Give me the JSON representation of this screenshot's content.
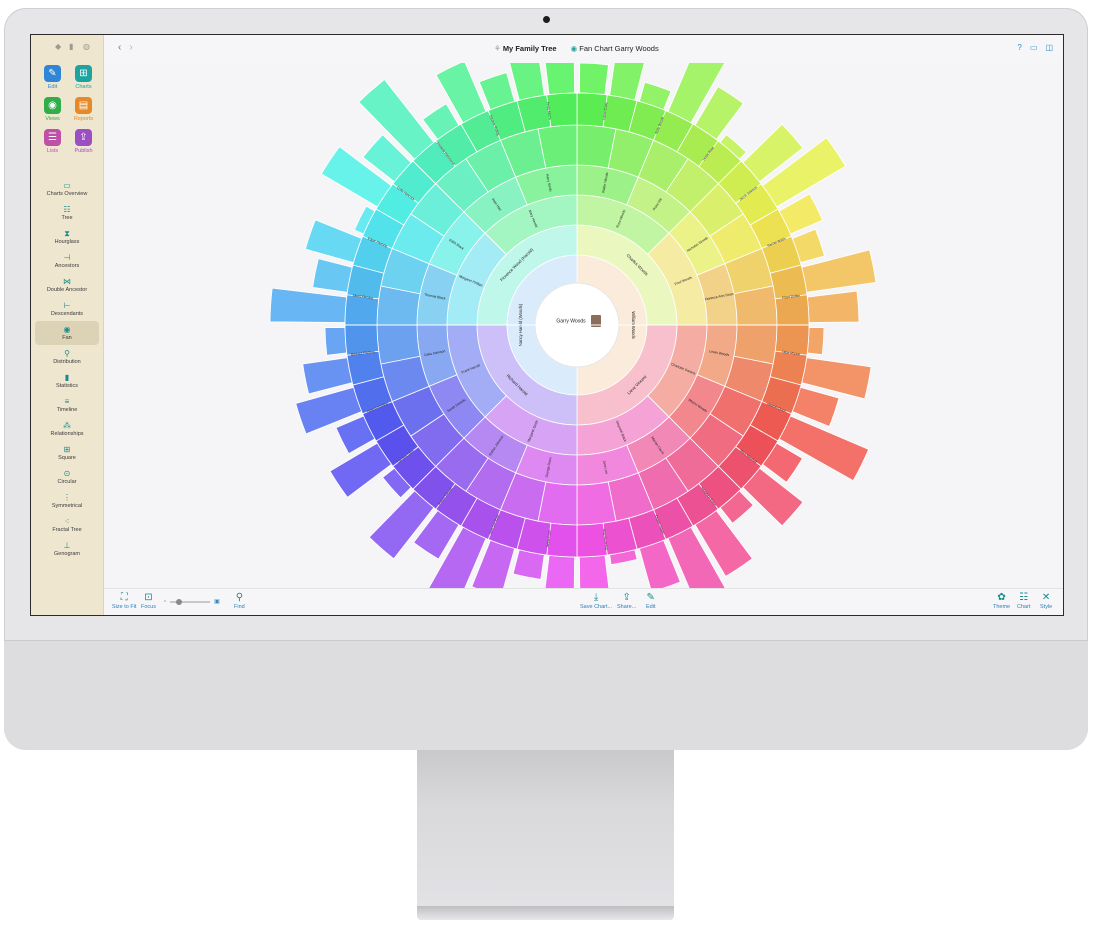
{
  "window": {
    "project_title": "My Family Tree",
    "chart_title": "Fan Chart Garry Woods"
  },
  "sidebar": {
    "modes": [
      {
        "label": "Edit",
        "icon": "pencil-icon",
        "color": "#2f86d6",
        "glyph": "✎"
      },
      {
        "label": "Charts",
        "icon": "charts-icon",
        "color": "#1fa3a0",
        "glyph": "⊞"
      },
      {
        "label": "Views",
        "icon": "eye-icon",
        "color": "#2fae4a",
        "glyph": "◉"
      },
      {
        "label": "Reports",
        "icon": "report-icon",
        "color": "#e48a2a",
        "glyph": "▤"
      },
      {
        "label": "Lists",
        "icon": "list-icon",
        "color": "#c04fa8",
        "glyph": "☰"
      },
      {
        "label": "Publish",
        "icon": "publish-icon",
        "color": "#9b4fc2",
        "glyph": "⇪"
      }
    ],
    "mode_label_colors": [
      "#2f86d6",
      "#1fa3a0",
      "#2fae4a",
      "#e48a2a",
      "#c04fa8",
      "#9b4fc2"
    ],
    "chart_types": [
      {
        "label": "Charts Overview",
        "glyph": "▭"
      },
      {
        "label": "Tree",
        "glyph": "☷"
      },
      {
        "label": "Hourglass",
        "glyph": "⧗"
      },
      {
        "label": "Ancestors",
        "glyph": "⊣"
      },
      {
        "label": "Double Ancestor",
        "glyph": "⋈"
      },
      {
        "label": "Descendants",
        "glyph": "⊢"
      },
      {
        "label": "Fan",
        "glyph": "◉"
      },
      {
        "label": "Distribution",
        "glyph": "⚲"
      },
      {
        "label": "Statistics",
        "glyph": "▮"
      },
      {
        "label": "Timeline",
        "glyph": "≡"
      },
      {
        "label": "Relationships",
        "glyph": "⁂"
      },
      {
        "label": "Square",
        "glyph": "⊞"
      },
      {
        "label": "Circular",
        "glyph": "⊙"
      },
      {
        "label": "Symmetrical",
        "glyph": "⋮"
      },
      {
        "label": "Fractal Tree",
        "glyph": "⁖"
      },
      {
        "label": "Genogram",
        "glyph": "⊥"
      }
    ],
    "active_chart": "Fan"
  },
  "bottom_toolbar": {
    "size_to_fit": "Size to Fit",
    "focus": "Focus",
    "find": "Find",
    "save_chart": "Save Chart...",
    "share": "Share...",
    "edit": "Edit",
    "theme": "Theme",
    "chart": "Chart",
    "style": "Style"
  },
  "fan_chart": {
    "root": "Garry Woods",
    "parents": [
      "William Woods",
      "Nancy Harold (Woods)"
    ],
    "grandparents": [
      "Charles Woods",
      "Lieve Vincent",
      "Richard Harold",
      "Florence Wood (Harold)"
    ],
    "ring3": [
      "Ross Woods",
      "Fred Woods",
      "Charlotte Daniels",
      "Gwyneth Black",
      "Margaret Smith",
      "Frank Harold",
      "Margaret Phillips",
      "Mary Harold"
    ],
    "ring4": [
      "Walter Woods",
      "Rose Hill",
      "Nicholas Woods",
      "Florence Ann Swan",
      "Lewis Woods",
      "Wayne Woods",
      "Marian Carrie",
      "Jane Lee",
      "George Dixon",
      "Esther Johnson",
      "Sarah Daniels",
      "Celia Johnson",
      "Thomas Black",
      "Edith Black",
      "Jean Hart",
      "Harry Smith"
    ],
    "outer_labels": [
      "Laura Brady",
      "Ruby Woods",
      "Leslie Rose",
      "Jacob Johnson",
      "Rachel Walsh",
      "Floyd Dobler",
      "Olive Morton",
      "Hannah Dixon",
      "Mary Marshall",
      "Josephine Eaton",
      "Elspeth Hayes",
      "Mary Browning",
      "Jennie Faith",
      "Jane Lee Ryan",
      "Robert Stewart",
      "Caroline Olive",
      "Helena Kissling",
      "Barbara Fleming",
      "Albert Fleming",
      "Edgar Fleming",
      "Lydia Hancock",
      "Frederik Hammond",
      "Eleanor Pulling",
      "Percy Morris"
    ]
  }
}
